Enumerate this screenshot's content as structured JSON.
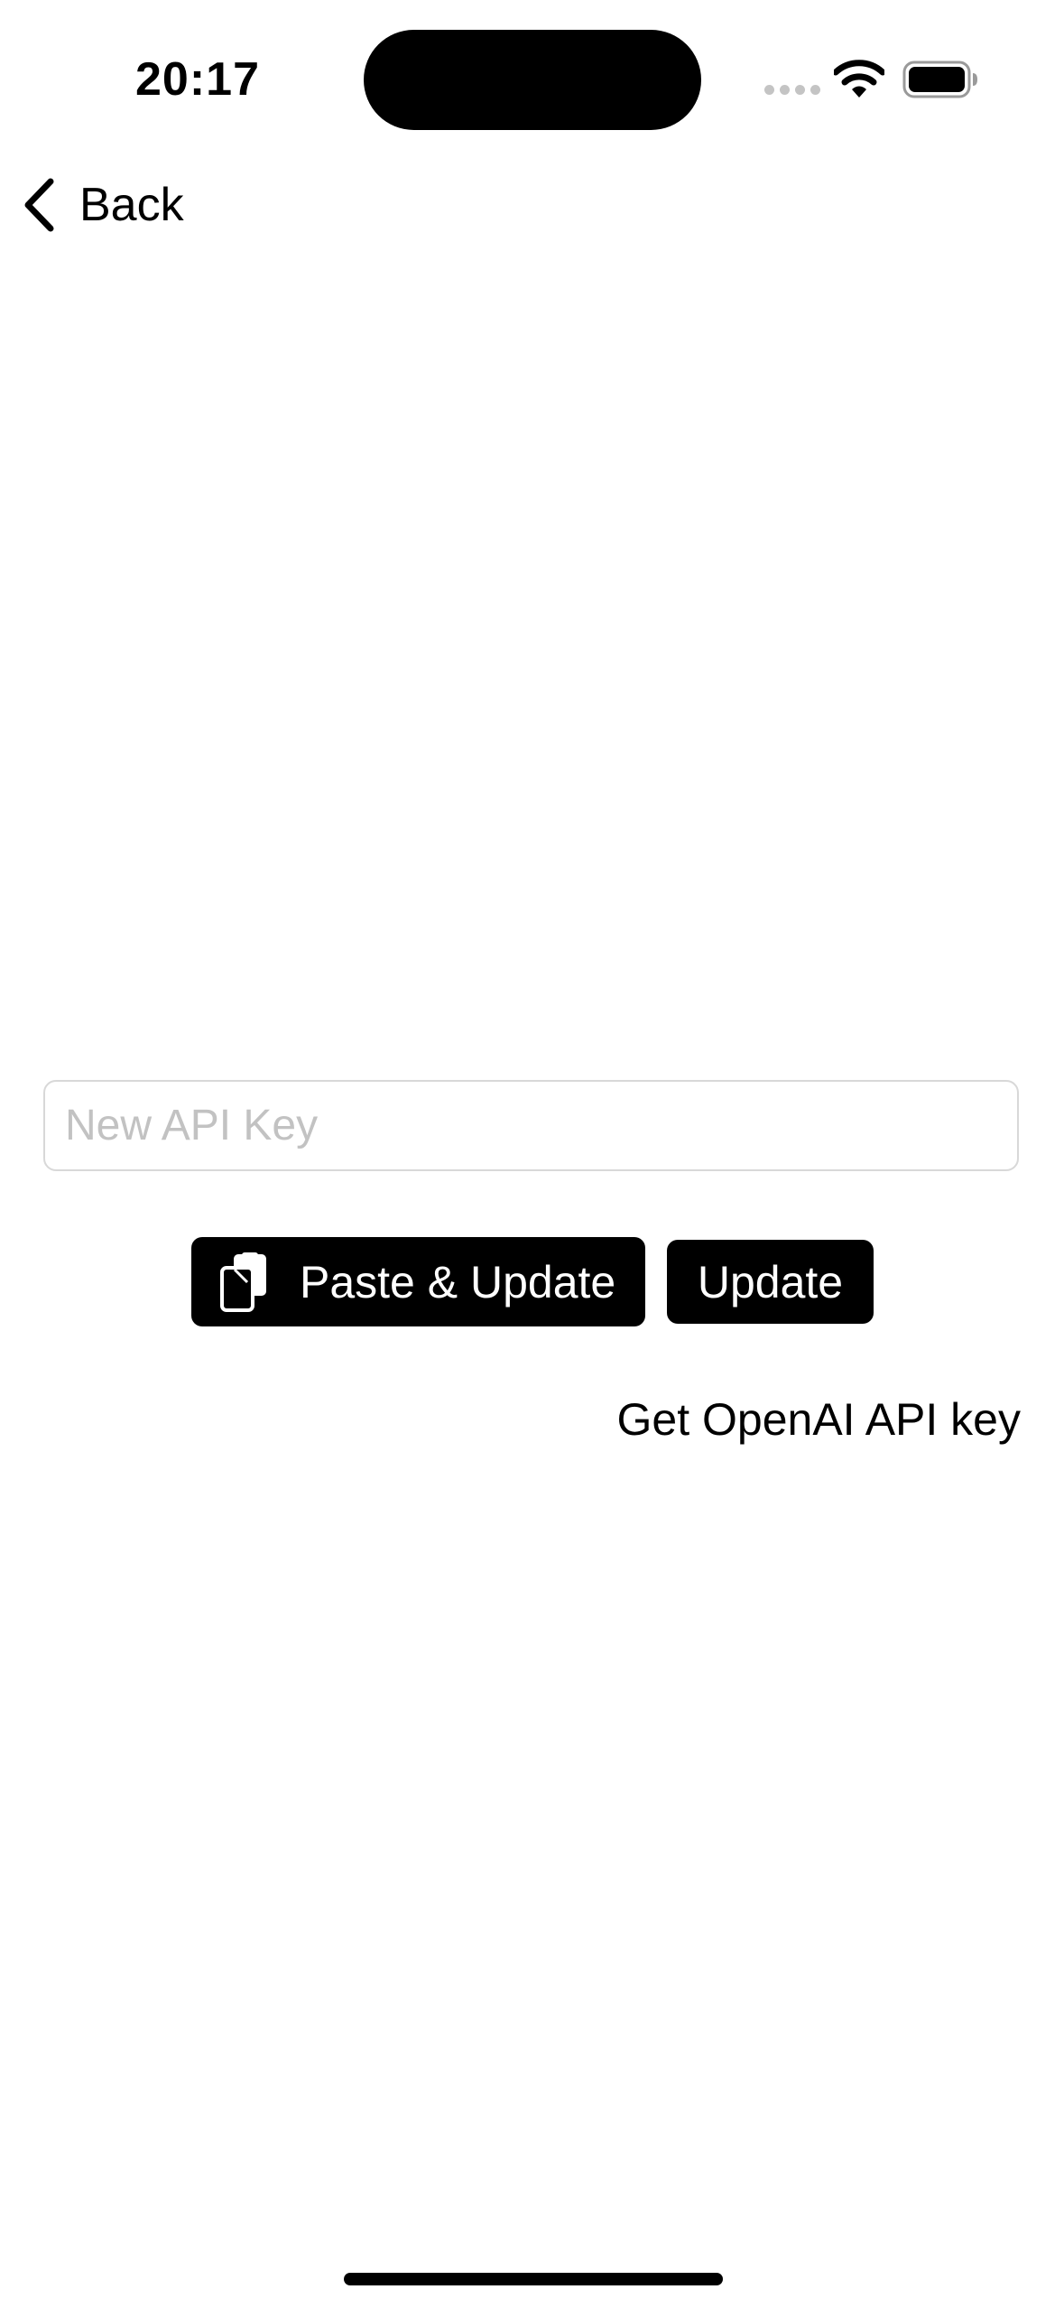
{
  "status_bar": {
    "time": "20:17",
    "icons": [
      "cellular-signal-icon",
      "wifi-icon",
      "battery-icon"
    ]
  },
  "nav": {
    "back_label": "Back",
    "back_icon": "chevron-left-icon"
  },
  "api_key_field": {
    "value": "",
    "placeholder": "New API Key"
  },
  "actions": {
    "paste_update_label": "Paste & Update",
    "paste_icon": "clipboard-icon",
    "update_label": "Update"
  },
  "link": {
    "get_key_label": "Get OpenAI API key"
  },
  "colors": {
    "background": "#ffffff",
    "button_background": "#000000",
    "button_text": "#ffffff",
    "placeholder": "#c2c2c2",
    "field_border": "#d8d8d8"
  }
}
